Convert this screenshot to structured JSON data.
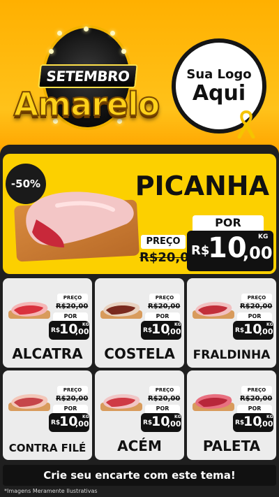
{
  "header": {
    "campaign_line1": "SETEMBRO",
    "campaign_line2": "Amarelo",
    "logo_line1": "Sua Logo",
    "logo_line2": "Aqui"
  },
  "featured": {
    "name": "PICANHA",
    "discount": "-50%",
    "label_preco": "PREÇO",
    "old_price": "R$20,00",
    "label_por": "POR",
    "currency": "R$",
    "price_int": "10",
    "price_cents": ",00",
    "unit": "KG"
  },
  "products": [
    {
      "name": "ALCATRA",
      "label_preco": "PREÇO",
      "old_price": "R$20,00",
      "label_por": "POR",
      "currency": "R$",
      "price_int": "10",
      "price_cents": ",00",
      "unit": "KG"
    },
    {
      "name": "COSTELA",
      "label_preco": "PREÇO",
      "old_price": "R$20,00",
      "label_por": "POR",
      "currency": "R$",
      "price_int": "10",
      "price_cents": ",00",
      "unit": "KG"
    },
    {
      "name": "FRALDINHA",
      "label_preco": "PREÇO",
      "old_price": "R$20,00",
      "label_por": "POR",
      "currency": "R$",
      "price_int": "10",
      "price_cents": ",00",
      "unit": "KG"
    },
    {
      "name": "CONTRA FILÉ",
      "label_preco": "PREÇO",
      "old_price": "R$20,00",
      "label_por": "POR",
      "currency": "R$",
      "price_int": "10",
      "price_cents": ",00",
      "unit": "KG"
    },
    {
      "name": "ACÉM",
      "label_preco": "PREÇO",
      "old_price": "R$20,00",
      "label_por": "POR",
      "currency": "R$",
      "price_int": "10",
      "price_cents": ",00",
      "unit": "KG"
    },
    {
      "name": "PALETA",
      "label_preco": "PREÇO",
      "old_price": "R$20,00",
      "label_por": "POR",
      "currency": "R$",
      "price_int": "10",
      "price_cents": ",00",
      "unit": "KG"
    }
  ],
  "footer": {
    "cta": "Crie seu encarte com este tema!",
    "disclaimer": "*Imagens Meramente Ilustrativas"
  },
  "colors": {
    "brand_yellow": "#fcd000",
    "panel_dark": "#1f1f1f",
    "card_bg": "#ececec"
  }
}
